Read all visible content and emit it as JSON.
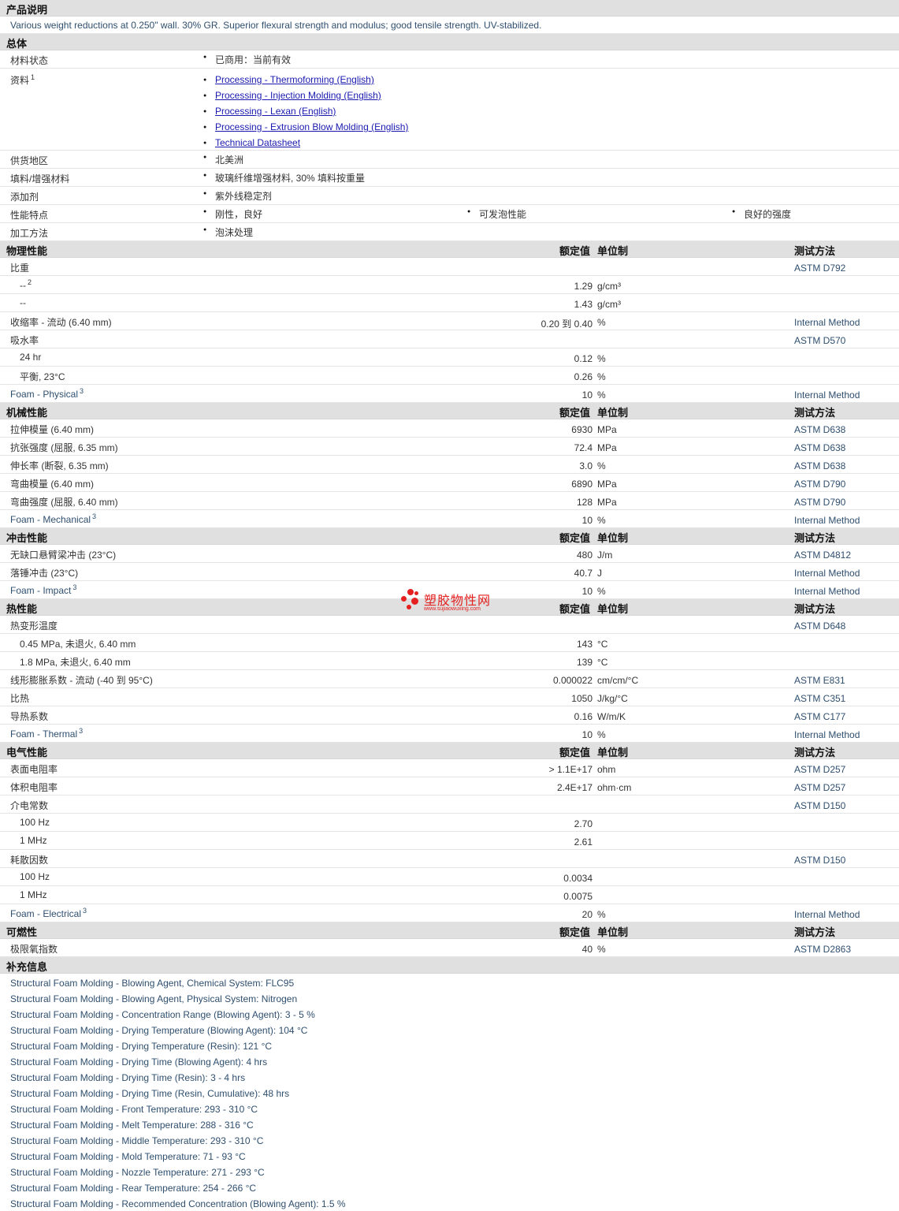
{
  "product_desc": {
    "heading": "产品说明",
    "text": "Various weight reductions at 0.250\" wall. 30% GR. Superior flexural strength and modulus; good tensile strength. UV-stabilized."
  },
  "general": {
    "heading": "总体",
    "material_status": {
      "label": "材料状态",
      "value": "已商用：当前有效"
    },
    "documents": {
      "label": "资料",
      "sup": "1",
      "links": [
        "Processing - Thermoforming (English)",
        "Processing - Injection Molding (English)",
        "Processing - Lexan (English)",
        "Processing - Extrusion Blow Molding (English)",
        "Technical Datasheet"
      ]
    },
    "availability": {
      "label": "供货地区",
      "value": "北美洲"
    },
    "filler": {
      "label": "填料/增强材料",
      "value": "玻璃纤维增强材料, 30% 填料按重量"
    },
    "additive": {
      "label": "添加剂",
      "value": "紫外线稳定剂"
    },
    "features": {
      "label": "性能特点",
      "values": [
        "刚性，良好",
        "可发泡性能",
        "良好的强度"
      ]
    },
    "processing": {
      "label": "加工方法",
      "value": "泡沫处理"
    }
  },
  "col_headers": {
    "nominal": "额定值",
    "unit": "单位制",
    "test": "测试方法"
  },
  "physical": {
    "heading": "物理性能",
    "rows": [
      {
        "label": "比重",
        "value": "",
        "unit": "",
        "test": "ASTM D792"
      },
      {
        "label": "--",
        "sup": "2",
        "sub": true,
        "value": "1.29",
        "unit": "g/cm³",
        "test": ""
      },
      {
        "label": "--",
        "sub": true,
        "value": "1.43",
        "unit": "g/cm³",
        "test": ""
      },
      {
        "label": "收缩率  - 流动  (6.40 mm)",
        "value": "0.20 到  0.40",
        "unit": "%",
        "test": "Internal Method"
      },
      {
        "label": "吸水率",
        "value": "",
        "unit": "",
        "test": "ASTM D570"
      },
      {
        "label": "24 hr",
        "sub": true,
        "value": "0.12",
        "unit": "%",
        "test": ""
      },
      {
        "label": "平衡, 23°C",
        "sub": true,
        "value": "0.26",
        "unit": "%",
        "test": ""
      },
      {
        "label": "Foam - Physical",
        "sup": "3",
        "blue": true,
        "value": "10",
        "unit": "%",
        "test": "Internal Method"
      }
    ]
  },
  "mechanical": {
    "heading": "机械性能",
    "rows": [
      {
        "label": "拉伸模量  (6.40 mm)",
        "value": "6930",
        "unit": "MPa",
        "test": "ASTM D638"
      },
      {
        "label": "抗张强度  (屈服, 6.35 mm)",
        "value": "72.4",
        "unit": "MPa",
        "test": "ASTM D638"
      },
      {
        "label": "伸长率  (断裂, 6.35 mm)",
        "value": "3.0",
        "unit": "%",
        "test": "ASTM D638"
      },
      {
        "label": "弯曲模量  (6.40 mm)",
        "value": "6890",
        "unit": "MPa",
        "test": "ASTM D790"
      },
      {
        "label": "弯曲强度  (屈服, 6.40 mm)",
        "value": "128",
        "unit": "MPa",
        "test": "ASTM D790"
      },
      {
        "label": "Foam - Mechanical",
        "sup": "3",
        "blue": true,
        "value": "10",
        "unit": "%",
        "test": "Internal Method"
      }
    ]
  },
  "impact": {
    "heading": "冲击性能",
    "rows": [
      {
        "label": "无缺口悬臂梁冲击  (23°C)",
        "value": "480",
        "unit": "J/m",
        "test": "ASTM D4812"
      },
      {
        "label": "落锤冲击  (23°C)",
        "value": "40.7",
        "unit": "J",
        "test": "Internal Method"
      },
      {
        "label": "Foam - Impact",
        "sup": "3",
        "blue": true,
        "value": "10",
        "unit": "%",
        "test": "Internal Method"
      }
    ]
  },
  "thermal": {
    "heading": "热性能",
    "rows": [
      {
        "label": "热变形温度",
        "value": "",
        "unit": "",
        "test": "ASTM D648"
      },
      {
        "label": "0.45 MPa, 未退火, 6.40 mm",
        "sub": true,
        "value": "143",
        "unit": "°C",
        "test": ""
      },
      {
        "label": "1.8 MPa, 未退火, 6.40 mm",
        "sub": true,
        "value": "139",
        "unit": "°C",
        "test": ""
      },
      {
        "label": "线形膨胀系数  - 流动  (-40 到  95°C)",
        "value": "0.000022",
        "unit": "cm/cm/°C",
        "test": "ASTM E831"
      },
      {
        "label": "比热",
        "value": "1050",
        "unit": "J/kg/°C",
        "test": "ASTM C351"
      },
      {
        "label": "导热系数",
        "value": "0.16",
        "unit": "W/m/K",
        "test": "ASTM C177"
      },
      {
        "label": "Foam - Thermal",
        "sup": "3",
        "blue": true,
        "value": "10",
        "unit": "%",
        "test": "Internal Method"
      }
    ]
  },
  "electrical": {
    "heading": "电气性能",
    "rows": [
      {
        "label": "表面电阻率",
        "value": "> 1.1E+17",
        "unit": "ohm",
        "test": "ASTM D257"
      },
      {
        "label": "体积电阻率",
        "value": "2.4E+17",
        "unit": "ohm·cm",
        "test": "ASTM D257"
      },
      {
        "label": "介电常数",
        "value": "",
        "unit": "",
        "test": "ASTM D150"
      },
      {
        "label": "100 Hz",
        "sub": true,
        "value": "2.70",
        "unit": "",
        "test": ""
      },
      {
        "label": "1 MHz",
        "sub": true,
        "value": "2.61",
        "unit": "",
        "test": ""
      },
      {
        "label": "耗散因数",
        "value": "",
        "unit": "",
        "test": "ASTM D150"
      },
      {
        "label": "100 Hz",
        "sub": true,
        "value": "0.0034",
        "unit": "",
        "test": ""
      },
      {
        "label": "1 MHz",
        "sub": true,
        "value": "0.0075",
        "unit": "",
        "test": ""
      },
      {
        "label": "Foam - Electrical",
        "sup": "3",
        "blue": true,
        "value": "20",
        "unit": "%",
        "test": "Internal Method"
      }
    ]
  },
  "flammability": {
    "heading": "可燃性",
    "rows": [
      {
        "label": "极限氧指数",
        "value": "40",
        "unit": "%",
        "test": "ASTM D2863"
      }
    ]
  },
  "supplemental": {
    "heading": "补充信息",
    "lines": [
      "Structural Foam Molding - Blowing Agent, Chemical System: FLC95",
      "Structural Foam Molding - Blowing Agent, Physical System: Nitrogen",
      "Structural Foam Molding - Concentration Range (Blowing Agent): 3 - 5 %",
      "Structural Foam Molding - Drying Temperature (Blowing Agent): 104 °C",
      "Structural Foam Molding - Drying Temperature (Resin): 121 °C",
      "Structural Foam Molding - Drying Time (Blowing Agent): 4 hrs",
      "Structural Foam Molding - Drying Time (Resin): 3 - 4 hrs",
      "Structural Foam Molding - Drying Time (Resin, Cumulative): 48 hrs",
      "Structural Foam Molding - Front Temperature: 293 - 310 °C",
      "Structural Foam Molding - Melt Temperature: 288 - 316 °C",
      "Structural Foam Molding - Middle Temperature: 293 - 310 °C",
      "Structural Foam Molding - Mold Temperature: 71 - 93 °C",
      "Structural Foam Molding - Nozzle Temperature: 271 - 293 °C",
      "Structural Foam Molding - Rear Temperature: 254 - 266 °C",
      "Structural Foam Molding - Recommended Concentration (Blowing Agent): 1.5 %"
    ]
  },
  "watermark": {
    "title": "塑胶物性网",
    "url": "www.sujiaowuxing.com"
  },
  "colors": {
    "section_bg": "#e0e0e0",
    "link": "#1a1ab0",
    "text_blue": "#2f4f6f",
    "watermark": "#e42020"
  }
}
